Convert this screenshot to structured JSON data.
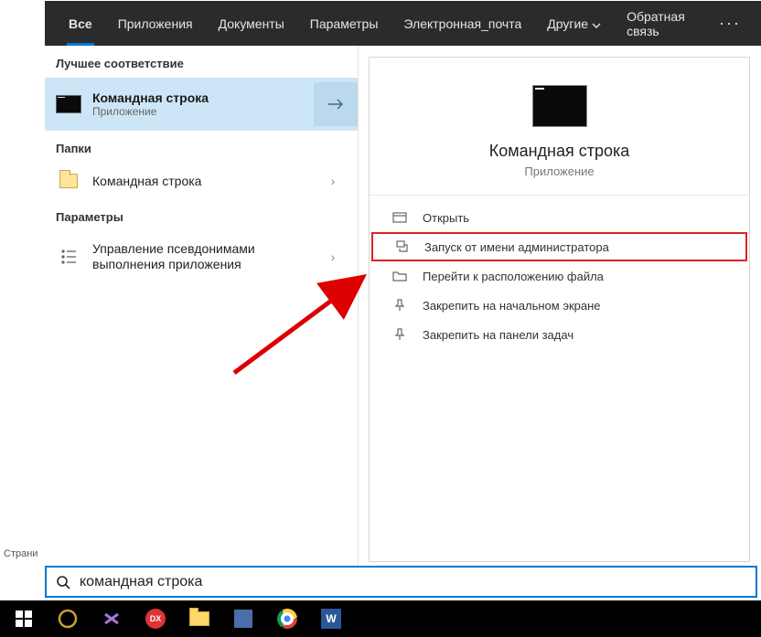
{
  "topbar": {
    "tabs": [
      {
        "label": "Все",
        "active": true
      },
      {
        "label": "Приложения"
      },
      {
        "label": "Документы"
      },
      {
        "label": "Параметры"
      },
      {
        "label": "Электронная_почта"
      },
      {
        "label": "Другие",
        "dropdown": true
      }
    ],
    "feedback": "Обратная связь",
    "more": "···"
  },
  "leftstub": {
    "corner": "Страни"
  },
  "results": {
    "groups": {
      "best": {
        "title": "Лучшее соответствие"
      },
      "folders": {
        "title": "Папки"
      },
      "settings": {
        "title": "Параметры"
      }
    },
    "best_item": {
      "name": "Командная строка",
      "sub": "Приложение"
    },
    "folder_item": {
      "name": "Командная строка"
    },
    "settings_item": {
      "name": "Управление псевдонимами выполнения приложения"
    }
  },
  "detail": {
    "title": "Командная строка",
    "sub": "Приложение",
    "actions": {
      "open": "Открыть",
      "admin": "Запуск от имени администратора",
      "location": "Перейти к расположению файла",
      "pin_start": "Закрепить на начальном экране",
      "pin_task": "Закрепить на панели задач"
    }
  },
  "search": {
    "value": "командная строка"
  },
  "icons": {
    "chevron": "›"
  }
}
